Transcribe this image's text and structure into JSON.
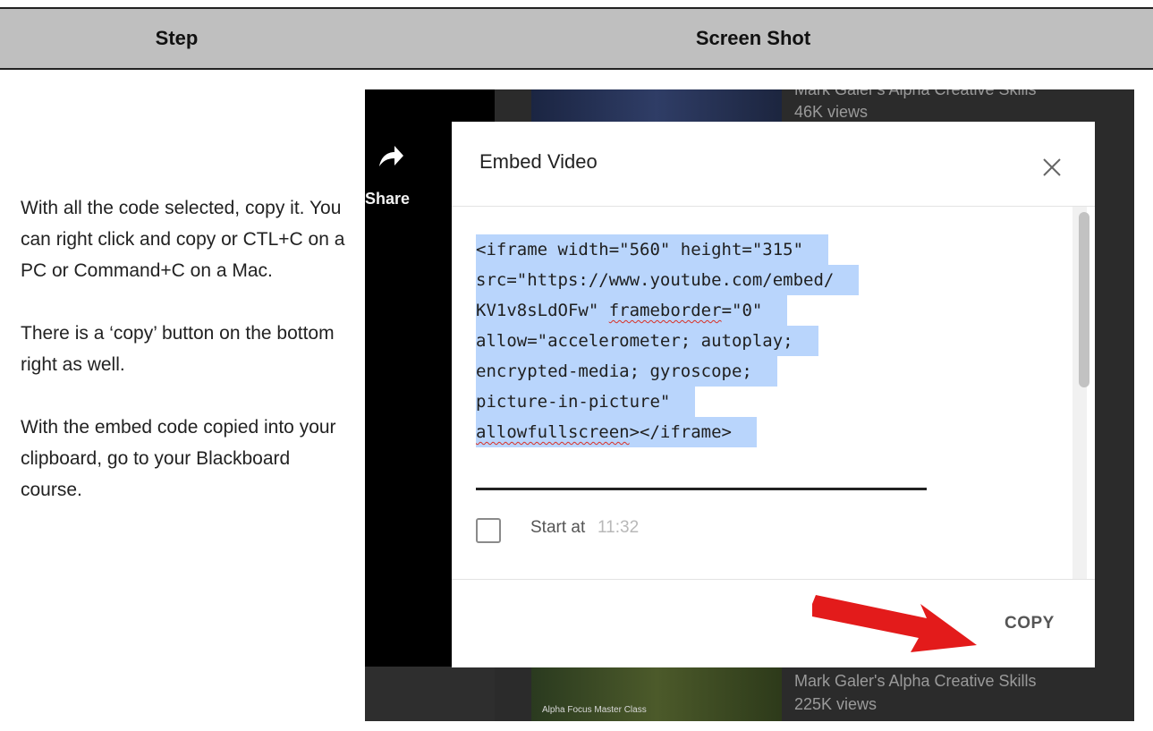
{
  "table": {
    "header_step": "Step",
    "header_screenshot": "Screen Shot"
  },
  "step": {
    "paragraphs": [
      "With all the code selected, copy it.  You can right click and copy or CTL+C on a PC or Command+C on a Mac.",
      "There is a ‘copy’ button on the bottom right as well.",
      "With the embed code copied into your clipboard, go to your Blackboard course."
    ]
  },
  "screenshot": {
    "share_label": "Share",
    "share_icon": "share-arrow-icon",
    "top_video": {
      "title": "Mark Galer's Alpha Creative Skills",
      "views": "46K views"
    },
    "bottom_video": {
      "title": "Mark Galer's Alpha Creative Skills",
      "views": "225K views",
      "thumb_caption": "Alpha Focus Master Class"
    },
    "modal": {
      "title": "Embed Video",
      "close_icon": "close-icon",
      "code_lines": [
        "<iframe width=\"560\" height=\"315\"",
        "src=\"https://www.youtube.com/embed/",
        "KV1v8sLdOFw\" frameborder=\"0\"",
        "allow=\"accelerometer; autoplay;",
        "encrypted-media; gyroscope;",
        "picture-in-picture\"",
        "allowfullscreen></iframe>"
      ],
      "start_at_label": "Start at",
      "start_at_time": "11:32",
      "copy_button": "COPY"
    },
    "colors": {
      "selection": "#b9d5fc",
      "arrow": "#e31b1b",
      "header_bg": "#bfbfbf"
    }
  }
}
